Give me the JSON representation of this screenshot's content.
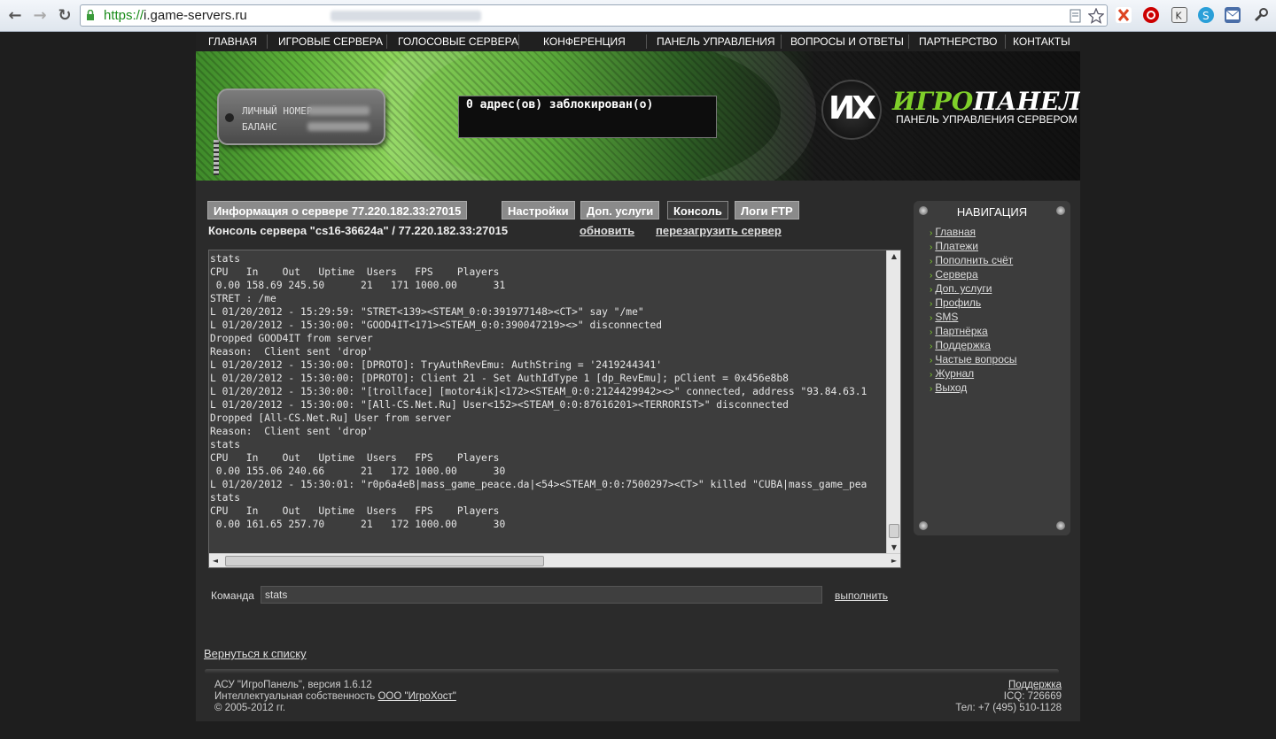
{
  "browser": {
    "url_scheme": "https://",
    "url_host": "i.game-servers.ru"
  },
  "topnav": [
    "ГЛАВНАЯ",
    "ИГРОВЫЕ СЕРВЕРА",
    "ГОЛОСОВЫЕ СЕРВЕРА",
    "КОНФЕРЕНЦИЯ",
    "ПАНЕЛЬ УПРАВЛЕНИЯ",
    "ВОПРОСЫ И ОТВЕТЫ",
    "ПАРТНЕРСТВО",
    "КОНТАКТЫ"
  ],
  "banner": {
    "account_label": "ЛИЧНЫЙ НОМЕР",
    "balance_label": "БАЛАНС",
    "blocked_text": "0 адрес(ов) заблокирован(о)",
    "logo_mark": "ИХ",
    "logo_green": "ИГРО",
    "logo_white": "ПАНЕЛЬ",
    "logo_sub": "ПАНЕЛЬ УПРАВЛЕНИЯ СЕРВЕРОМ"
  },
  "tabs": [
    "Информация о сервере 77.220.182.33:27015",
    "Настройки",
    "Доп. услуги",
    "Консоль",
    "Логи FTP"
  ],
  "console": {
    "title": "Консоль сервера \"cs16-36624a\" / 77.220.182.33:27015",
    "refresh": "обновить",
    "restart": "перезагрузить сервер",
    "lines": [
      "stats",
      "CPU   In    Out   Uptime  Users   FPS    Players",
      " 0.00 158.69 245.50      21   171 1000.00      31",
      "STRET : /me",
      "L 01/20/2012 - 15:29:59: \"STRET<139><STEAM_0:0:391977148><CT>\" say \"/me\"",
      "L 01/20/2012 - 15:30:00: \"GOOD4IT<171><STEAM_0:0:390047219><>\" disconnected",
      "Dropped GOOD4IT from server",
      "Reason:  Client sent 'drop'",
      "L 01/20/2012 - 15:30:00: [DPROTO]: TryAuthRevEmu: AuthString = '2419244341'",
      "L 01/20/2012 - 15:30:00: [DPROTO]: Client 21 - Set AuthIdType 1 [dp_RevEmu]; pClient = 0x456e8b8",
      "L 01/20/2012 - 15:30:00: \"[trollface] [motor4ik]<172><STEAM_0:0:2124429942><>\" connected, address \"93.84.63.1",
      "L 01/20/2012 - 15:30:00: \"[All-CS.Net.Ru] User<152><STEAM_0:0:87616201><TERRORIST>\" disconnected",
      "Dropped [All-CS.Net.Ru] User from server",
      "Reason:  Client sent 'drop'",
      "stats",
      "CPU   In    Out   Uptime  Users   FPS    Players",
      " 0.00 155.06 240.66      21   172 1000.00      30",
      "L 01/20/2012 - 15:30:01: \"r0p6a4eB|mass_game_peace.da|<54><STEAM_0:0:7500297><CT>\" killed \"CUBA|mass_game_pea",
      "stats",
      "CPU   In    Out   Uptime  Users   FPS    Players",
      " 0.00 161.65 257.70      21   172 1000.00      30"
    ]
  },
  "command": {
    "label": "Команда",
    "value": "stats",
    "execute": "выполнить"
  },
  "sidebar": {
    "title": "НАВИГАЦИЯ",
    "items": [
      "Главная",
      "Платежи",
      "Пополнить счёт",
      "Сервера",
      "Доп. услуги",
      "Профиль",
      "SMS",
      "Партнёрка",
      "Поддержка",
      "Частые вопросы",
      "Журнал",
      "Выход"
    ]
  },
  "back_link": "Вернуться к списку",
  "footer": {
    "line1": "АСУ \"ИгроПанель\", версия 1.6.12",
    "line2_prefix": "Интеллектуальная собственность ",
    "line2_link": "ООО \"ИгроХост\"",
    "line3": "© 2005-2012 гг.",
    "support": "Поддержка",
    "icq": "ICQ: 726669",
    "phone": "Тел: +7 (495) 510-1128"
  },
  "colors": {
    "accent_green": "#7fcf2a",
    "page_bg": "#2b2b2b",
    "console_bg": "#3d3d3d"
  }
}
